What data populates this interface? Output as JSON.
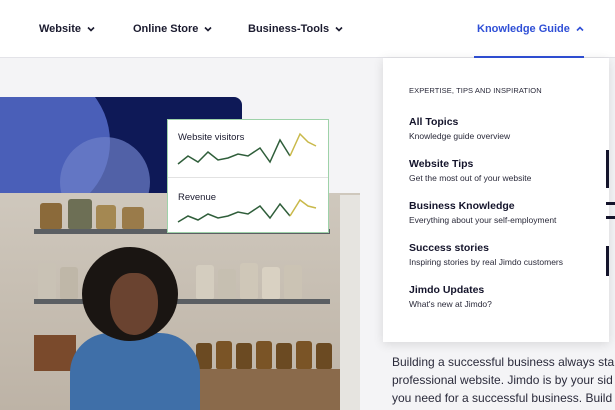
{
  "nav": {
    "items": [
      {
        "label": "Website"
      },
      {
        "label": "Online Store"
      },
      {
        "label": "Business-Tools"
      },
      {
        "label": "Knowledge Guide"
      }
    ],
    "active_color": "#2f4fd6"
  },
  "stats_card": {
    "label_1": "Website visitors",
    "label_2": "Revenue"
  },
  "dropdown": {
    "caption": "EXPERTISE, TIPS AND INSPIRATION",
    "items": [
      {
        "title": "All Topics",
        "subtitle": "Knowledge guide overview"
      },
      {
        "title": "Website Tips",
        "subtitle": "Get the most out of your website"
      },
      {
        "title": "Business Knowledge",
        "subtitle": "Everything about your self-employment"
      },
      {
        "title": "Success stories",
        "subtitle": "Inspiring stories by real Jimdo customers"
      },
      {
        "title": "Jimdo Updates",
        "subtitle": "What's new at Jimdo?"
      }
    ]
  },
  "body_text": {
    "line_1": "Building a successful business always sta",
    "line_2": "professional website. Jimdo is by your sid",
    "line_3": "you need for a successful business. Build"
  },
  "colors": {
    "brand_blue": "#2f4fd6",
    "hero_navy": "#0e1957",
    "chart_line": "#2f5e3a",
    "chart_highlight": "#c9b94a"
  }
}
